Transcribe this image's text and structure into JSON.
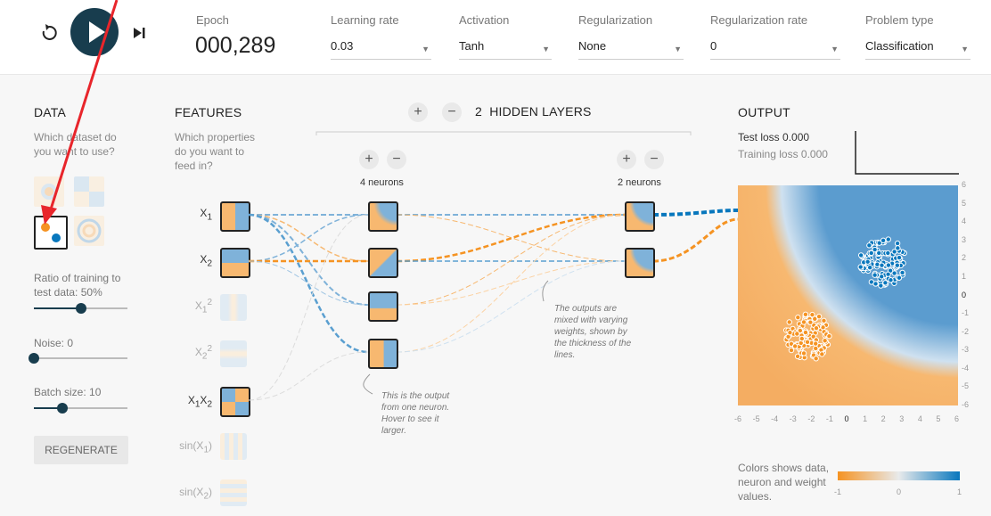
{
  "topbar": {
    "epoch_label": "Epoch",
    "epoch_value": "000,289",
    "learning_rate": {
      "label": "Learning rate",
      "value": "0.03"
    },
    "activation": {
      "label": "Activation",
      "value": "Tanh"
    },
    "regularization": {
      "label": "Regularization",
      "value": "None"
    },
    "regularization_rate": {
      "label": "Regularization rate",
      "value": "0"
    },
    "problem_type": {
      "label": "Problem type",
      "value": "Classification"
    }
  },
  "data_panel": {
    "title": "DATA",
    "question": "Which dataset do you want to use?",
    "ratio_label": "Ratio of training to test data:",
    "ratio_value": "50%",
    "ratio_fraction": 0.5,
    "noise_label": "Noise:",
    "noise_value": "0",
    "noise_fraction": 0.0,
    "batch_label": "Batch size:",
    "batch_value": "10",
    "batch_fraction": 0.3,
    "regenerate_label": "REGENERATE"
  },
  "features": {
    "title": "FEATURES",
    "question": "Which properties do you want to feed in?"
  },
  "network": {
    "layers_count": "2",
    "layers_label": "HIDDEN LAYERS",
    "layer1_neurons": "4 neurons",
    "layer2_neurons": "2 neurons",
    "note_neuron": "This is the output from one neuron. Hover to see it larger.",
    "note_weights": "The outputs are mixed with varying weights, shown by the thickness of the lines."
  },
  "output": {
    "title": "OUTPUT",
    "test_loss": "Test loss 0.000",
    "training_loss": "Training loss 0.000",
    "colors_note": "Colors shows data, neuron and weight values.",
    "scale_min": "-1",
    "scale_mid": "0",
    "scale_max": "1",
    "x_ticks": [
      "-6",
      "-5",
      "-4",
      "-3",
      "-2",
      "-1",
      "0",
      "1",
      "2",
      "3",
      "4",
      "5",
      "6"
    ],
    "y_ticks": [
      "6",
      "5",
      "4",
      "3",
      "2",
      "1",
      "0",
      "-1",
      "-2",
      "-3",
      "-4",
      "-5",
      "-6"
    ]
  },
  "colors": {
    "orange": "#f59322",
    "blue": "#0877bd",
    "dark": "#183d4e",
    "annotation_arrow": "#e8252b"
  }
}
